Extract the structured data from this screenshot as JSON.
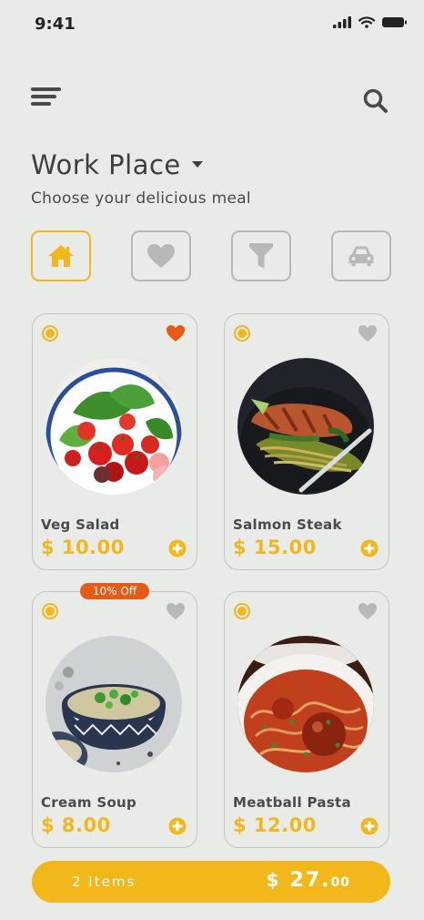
{
  "status": {
    "time": "9:41"
  },
  "header": {
    "location": "Work Place",
    "subtitle": "Choose your delicious meal"
  },
  "categories": [
    {
      "icon": "home-icon",
      "active": true
    },
    {
      "icon": "heart-icon",
      "active": false
    },
    {
      "icon": "filter-icon",
      "active": false
    },
    {
      "icon": "car-icon",
      "active": false
    }
  ],
  "items": [
    {
      "name": "Veg Salad",
      "price": "$ 10.00",
      "favorite": true
    },
    {
      "name": "Salmon Steak",
      "price": "$ 15.00",
      "favorite": false
    },
    {
      "name": "Cream Soup",
      "price": "$ 8.00",
      "favorite": false,
      "badge": "10% Off"
    },
    {
      "name": "Meatball Pasta",
      "price": "$ 12.00",
      "favorite": false
    }
  ],
  "cart": {
    "items": "2 Items",
    "currency": "$",
    "total_main": "27.",
    "total_cents": "00"
  },
  "colors": {
    "accent": "#f2b81b",
    "favorite": "#e65a14",
    "inactive": "#b8b8b8",
    "background": "#e8ebe8"
  }
}
